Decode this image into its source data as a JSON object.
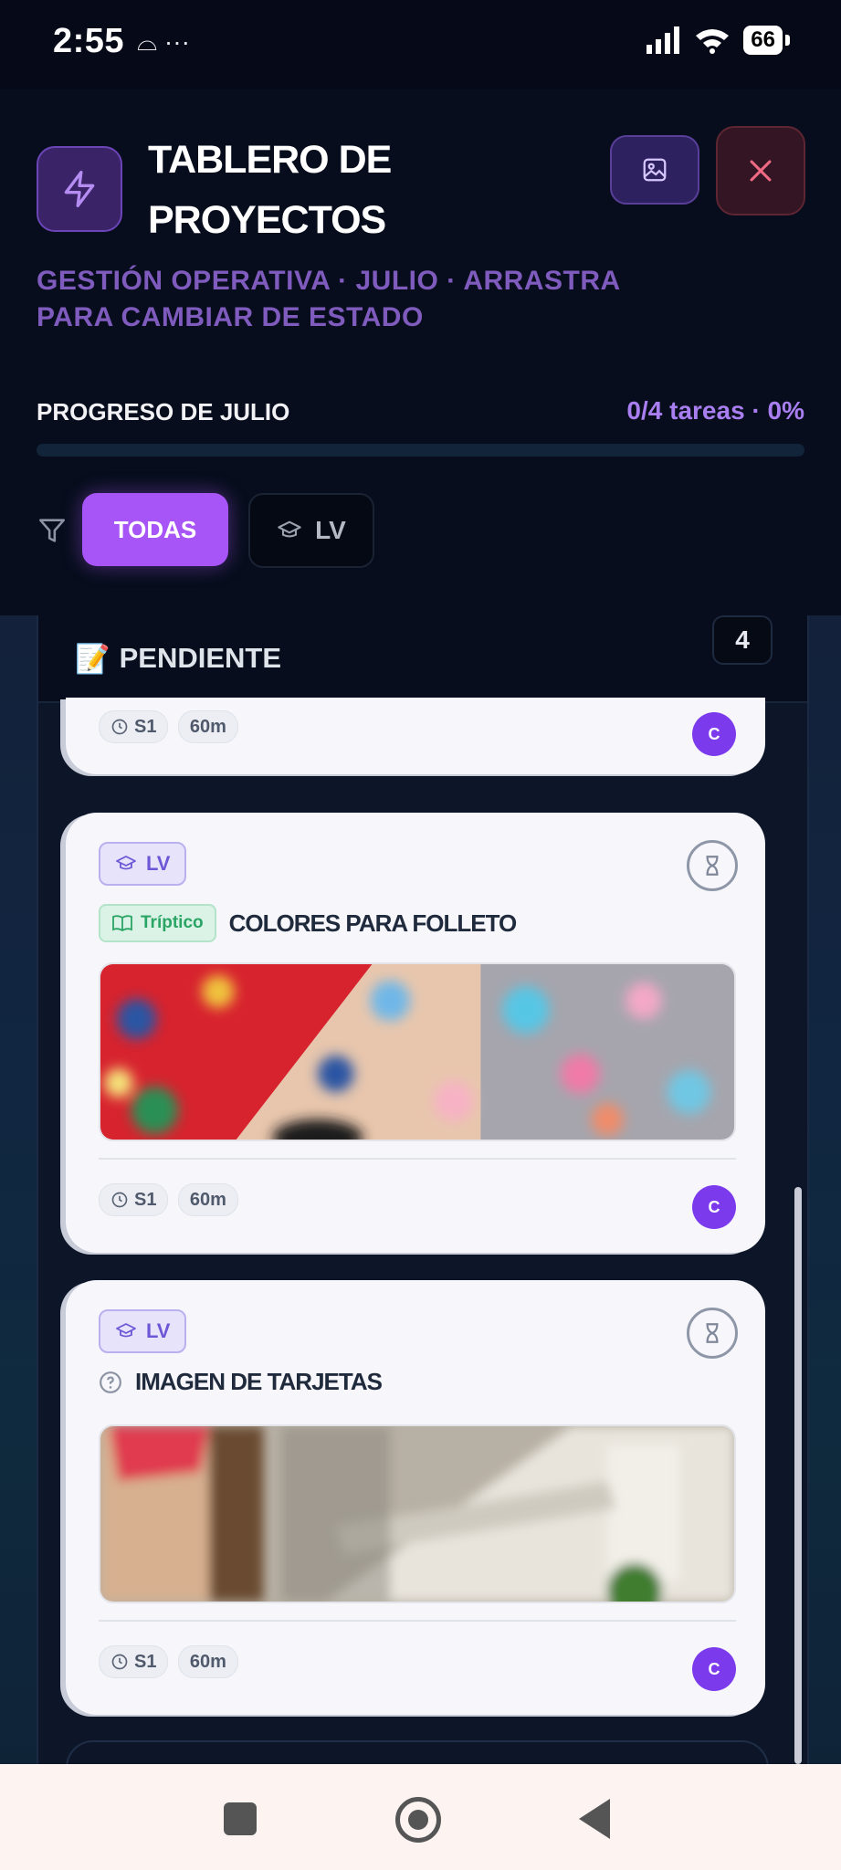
{
  "status_bar": {
    "time": "2:55",
    "extra_icons": "⌓ ···",
    "battery": "66"
  },
  "header": {
    "title": "TABLERO DE PROYECTOS",
    "subtitle": "GESTIÓN OPERATIVA · JULIO · ARRASTRA PARA CAMBIAR DE ESTADO",
    "progress_label": "PROGRESO DE JULIO",
    "progress_value": "0/4 tareas · 0%",
    "progress_fraction": 0,
    "accent_color": "#a855f7"
  },
  "filters": {
    "all_label": "TODAS",
    "lv_label": "LV"
  },
  "column": {
    "emoji": "📝",
    "title": "PENDIENTE",
    "count": "4"
  },
  "cards": [
    {
      "session": "S1",
      "duration": "60m",
      "avatar": "C"
    },
    {
      "tag": "LV",
      "category": "Tríptico",
      "title": "COLORES PARA FOLLETO",
      "session": "S1",
      "duration": "60m",
      "avatar": "C"
    },
    {
      "tag": "LV",
      "title": "IMAGEN DE TARJETAS",
      "session": "S1",
      "duration": "60m",
      "avatar": "C"
    }
  ]
}
